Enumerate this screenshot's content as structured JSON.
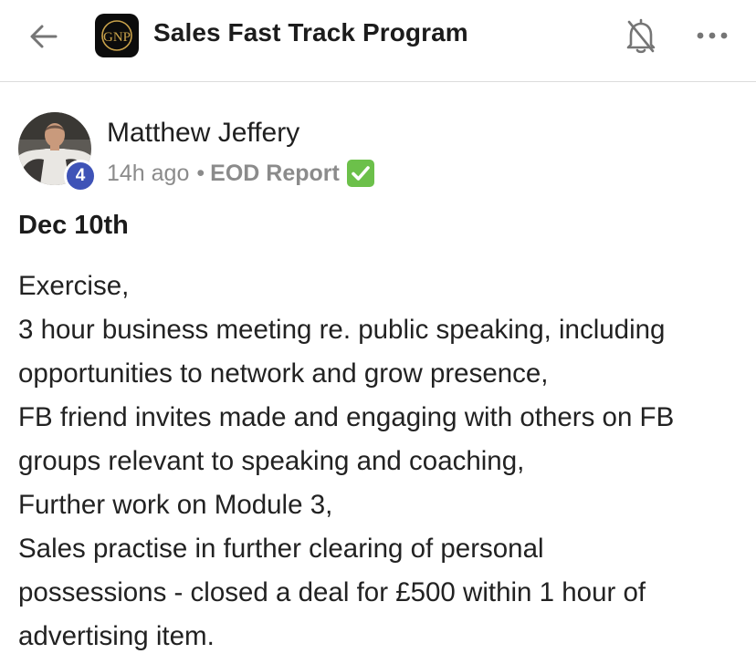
{
  "header": {
    "title": "Sales Fast Track Program",
    "logo_text": "GNP",
    "icons": {
      "back": "arrow-left-icon",
      "notifications": "bell-off-icon",
      "more": "more-horizontal-icon"
    }
  },
  "post": {
    "author": {
      "name": "Matthew Jeffery",
      "level": "4"
    },
    "time": "14h ago",
    "separator": "•",
    "category": "EOD Report",
    "category_emoji": "check-mark-button-icon",
    "title": "Dec 10th",
    "body_lines": [
      "Exercise,",
      "3 hour business meeting re. public speaking, including",
      "opportunities to network and grow presence,",
      "FB friend invites made and engaging with others on FB",
      "groups relevant to speaking and coaching,",
      "Further work on Module 3,",
      "Sales practise in further clearing of personal",
      "possessions - closed a deal for £500 within 1 hour of",
      "advertising item."
    ]
  },
  "colors": {
    "level_badge": "#3e53b7",
    "meta_text": "#8b8b8b",
    "check_emoji": "#6cc04a",
    "divider": "#dcdcdc"
  }
}
